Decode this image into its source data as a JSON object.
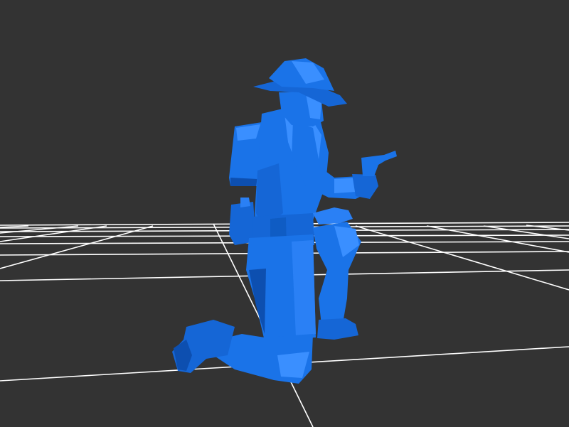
{
  "scene": {
    "background_color": "#333333",
    "grid_color": "#ffffff",
    "model_color": "#1a73e8",
    "model_highlight": "#3a8fff",
    "model_shadow": "#0d4fb0",
    "subject": "kneeling-soldier-with-revolver"
  }
}
